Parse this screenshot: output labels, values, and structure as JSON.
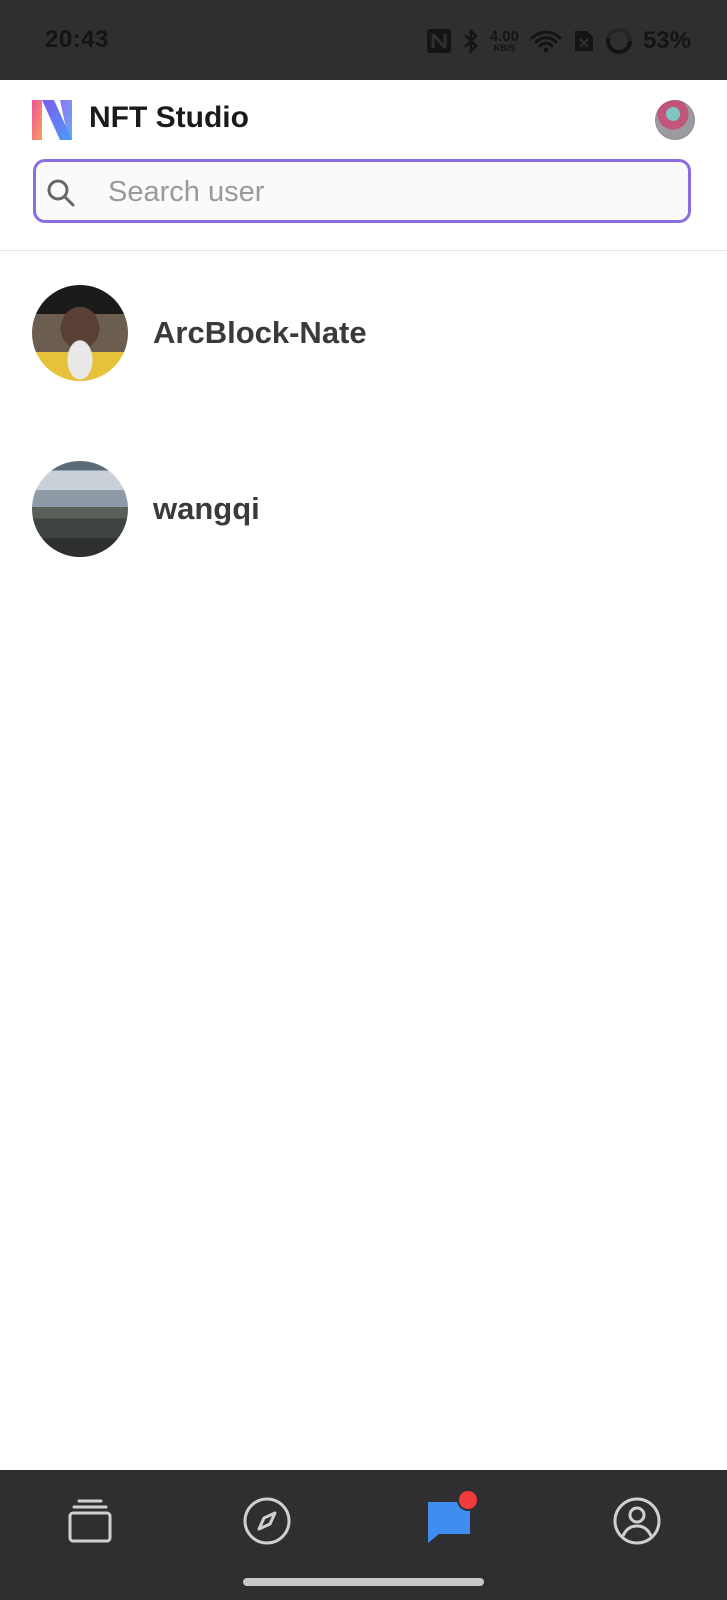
{
  "status_bar": {
    "time": "20:43",
    "net_speed_value": "4.00",
    "net_speed_unit": "KB/S",
    "battery": "53%",
    "icons": [
      "nfc-icon",
      "bluetooth-icon",
      "wifi-icon",
      "sim-off-icon",
      "battery-ring-icon"
    ]
  },
  "header": {
    "app_title": "NFT Studio",
    "logo": "nft-studio-logo",
    "avatar": "profile-avatar"
  },
  "search": {
    "placeholder": "Search user",
    "value": "",
    "accent_color": "#8a6ee0"
  },
  "users": [
    {
      "name": "ArcBlock-Nate",
      "avatar": "gorilla-avatar"
    },
    {
      "name": "wangqi",
      "avatar": "landscape-avatar"
    }
  ],
  "bottom_nav": {
    "items": [
      {
        "icon": "collection-stack-icon",
        "active": false
      },
      {
        "icon": "compass-icon",
        "active": false
      },
      {
        "icon": "chat-icon",
        "active": true,
        "has_badge": true
      },
      {
        "icon": "user-circle-icon",
        "active": false
      }
    ],
    "active_color": "#3d8ef0",
    "inactive_color": "#d0d0d0",
    "badge_color": "#f23b3b"
  }
}
